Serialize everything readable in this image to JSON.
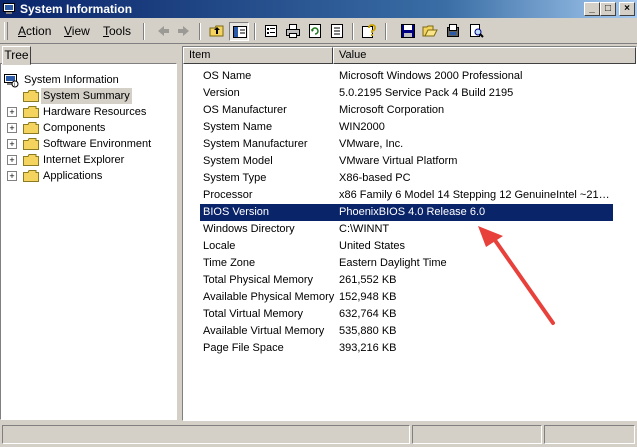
{
  "window": {
    "title": "System Information",
    "controls": {
      "minimize": "_",
      "maximize": "□",
      "close": "×"
    }
  },
  "menu": {
    "items": [
      {
        "label": "Action"
      },
      {
        "label": "View"
      },
      {
        "label": "Tools"
      }
    ]
  },
  "toolbar": {
    "icons": [
      "back-arrow-icon",
      "forward-arrow-icon",
      "up-folder-icon",
      "show-hide-tree-icon",
      "properties-icon",
      "print-icon",
      "refresh-icon",
      "export-icon",
      "help-icon",
      "save-icon",
      "open-icon",
      "print-report-icon",
      "find-icon"
    ]
  },
  "tree": {
    "tab_label": "Tree",
    "root": "System Information",
    "items": [
      {
        "label": "System Summary"
      },
      {
        "label": "Hardware Resources"
      },
      {
        "label": "Components"
      },
      {
        "label": "Software Environment"
      },
      {
        "label": "Internet Explorer"
      },
      {
        "label": "Applications"
      }
    ]
  },
  "list": {
    "columns": [
      "Item",
      "Value"
    ],
    "rows": [
      {
        "item": "OS Name",
        "value": "Microsoft Windows 2000 Professional"
      },
      {
        "item": "Version",
        "value": "5.0.2195 Service Pack 4 Build 2195"
      },
      {
        "item": "OS Manufacturer",
        "value": "Microsoft Corporation"
      },
      {
        "item": "System Name",
        "value": "WIN2000"
      },
      {
        "item": "System Manufacturer",
        "value": "VMware, Inc."
      },
      {
        "item": "System Model",
        "value": "VMware Virtual Platform"
      },
      {
        "item": "System Type",
        "value": "X86-based PC"
      },
      {
        "item": "Processor",
        "value": "x86 Family 6 Model 14 Stepping 12 GenuineIntel ~21…"
      },
      {
        "item": "BIOS Version",
        "value": "PhoenixBIOS 4.0 Release 6.0"
      },
      {
        "item": "Windows Directory",
        "value": "C:\\WINNT"
      },
      {
        "item": "Locale",
        "value": "United States"
      },
      {
        "item": "Time Zone",
        "value": "Eastern Daylight Time"
      },
      {
        "item": "Total Physical Memory",
        "value": "261,552 KB"
      },
      {
        "item": "Available Physical Memory",
        "value": "152,948 KB"
      },
      {
        "item": "Total Virtual Memory",
        "value": "632,764 KB"
      },
      {
        "item": "Available Virtual Memory",
        "value": "535,880 KB"
      },
      {
        "item": "Page File Space",
        "value": "393,216 KB"
      }
    ],
    "selected_item": "BIOS Version"
  },
  "colors": {
    "title_active": "#0a246a",
    "selection": "#0a246a",
    "annotation_arrow": "#e8403a"
  }
}
